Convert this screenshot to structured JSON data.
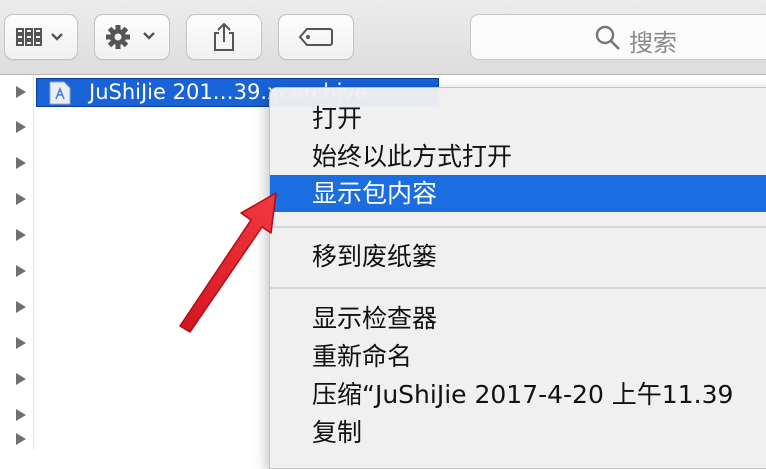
{
  "toolbar": {
    "search_placeholder": "搜索"
  },
  "file_list": {
    "selected_file": "JuShiJie 201…39.xcarchive",
    "collapsed_rows": 11
  },
  "context_menu": {
    "items": [
      "打开",
      "始终以此方式打开",
      "显示包内容",
      "移到废纸篓",
      "显示检查器",
      "重新命名",
      "压缩“JuShiJie 2017-4-20 上午11.39",
      "复制"
    ],
    "highlighted": "显示包内容"
  },
  "colors": {
    "selection": "#1763d7",
    "highlight": "#1c6de0",
    "annotation_arrow": "#e8202a"
  }
}
